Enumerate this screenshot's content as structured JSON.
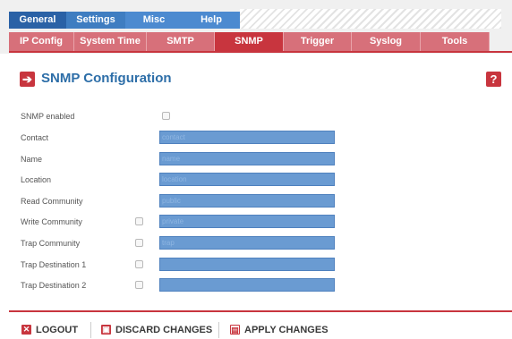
{
  "nav_primary": {
    "tabs": [
      {
        "label": "General",
        "color": "#2a61a6"
      },
      {
        "label": "Settings",
        "color": "#3f7dc1"
      },
      {
        "label": "Misc",
        "color": "#4c8ad0"
      },
      {
        "label": "Help",
        "color": "#4c8ad0"
      }
    ]
  },
  "nav_secondary": {
    "tabs": [
      {
        "label": "IP Config"
      },
      {
        "label": "System Time"
      },
      {
        "label": "SMTP"
      },
      {
        "label": "SNMP",
        "active": true
      },
      {
        "label": "Trigger"
      },
      {
        "label": "Syslog"
      },
      {
        "label": "Tools"
      }
    ]
  },
  "page": {
    "title": "SNMP Configuration",
    "title_icon": "arrow-right-icon",
    "help_icon": "question-mark-icon",
    "help_glyph": "?"
  },
  "form": {
    "snmp_enabled_label": "SNMP enabled",
    "fields": [
      {
        "label": "Contact",
        "placeholder": "contact"
      },
      {
        "label": "Name",
        "placeholder": "name"
      },
      {
        "label": "Location",
        "placeholder": "location"
      },
      {
        "label": "Read Community",
        "placeholder": "public"
      },
      {
        "label": "Write Community",
        "placeholder": "private"
      },
      {
        "label": "Trap Community",
        "placeholder": "trap"
      },
      {
        "label": "Trap Destination 1",
        "placeholder": ""
      },
      {
        "label": "Trap Destination 2",
        "placeholder": ""
      }
    ]
  },
  "actions": {
    "logout": "LOGOUT",
    "discard": "DISCARD CHANGES",
    "apply": "APPLY CHANGES"
  },
  "colors": {
    "accent_red": "#c8353e",
    "tab_red": "#d7707a",
    "input_blue": "#6a9bd2",
    "title_blue": "#2d6ea8"
  }
}
